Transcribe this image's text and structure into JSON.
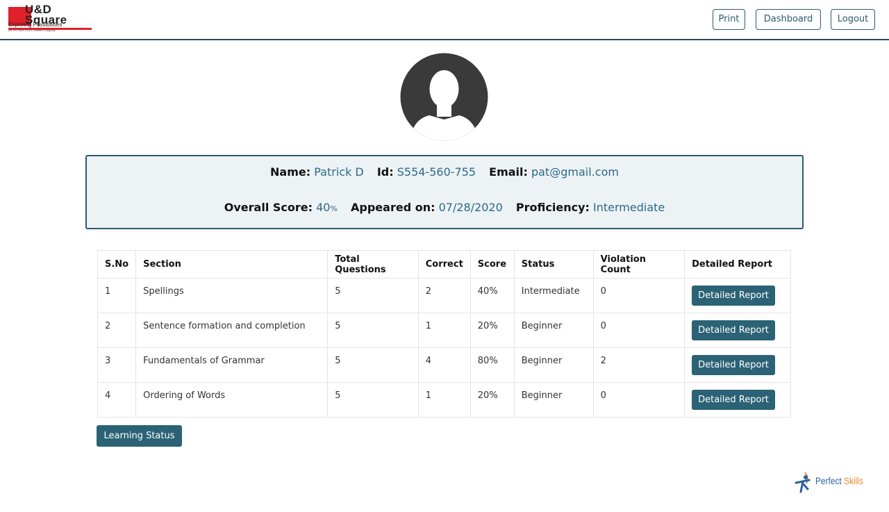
{
  "header": {
    "logo": {
      "brand": "U&D Square",
      "tagline": "Exploring Possibilities",
      "fine_print": "AN ISO 9001:2015 Certified Company"
    },
    "buttons": {
      "print": "Print",
      "dashboard": "Dashboard",
      "logout": "Logout"
    }
  },
  "profile": {
    "avatar_icon": "user-silhouette-icon",
    "name_label": "Name:",
    "name": "Patrick D",
    "id_label": "Id:",
    "id": "S554-560-755",
    "email_label": "Email:",
    "email": "pat@gmail.com",
    "overall_score_label": "Overall Score:",
    "overall_score": "40",
    "overall_score_unit": "%",
    "appeared_on_label": "Appeared on:",
    "appeared_on": "07/28/2020",
    "proficiency_label": "Proficiency:",
    "proficiency": "Intermediate"
  },
  "table": {
    "headers": [
      "S.No",
      "Section",
      "Total Questions",
      "Correct",
      "Score",
      "Status",
      "Violation Count",
      "Detailed Report"
    ],
    "rows": [
      {
        "sno": "1",
        "section": "Spellings",
        "total": "5",
        "correct": "2",
        "score": "40%",
        "status": "Intermediate",
        "violations": "0",
        "report": "Detailed Report"
      },
      {
        "sno": "2",
        "section": "Sentence formation and completion",
        "total": "5",
        "correct": "1",
        "score": "20%",
        "status": "Beginner",
        "violations": "0",
        "report": "Detailed Report"
      },
      {
        "sno": "3",
        "section": "Fundamentals of Grammar",
        "total": "5",
        "correct": "4",
        "score": "80%",
        "status": "Beginner",
        "violations": "2",
        "report": "Detailed Report"
      },
      {
        "sno": "4",
        "section": "Ordering of Words",
        "total": "5",
        "correct": "1",
        "score": "20%",
        "status": "Beginner",
        "violations": "0",
        "report": "Detailed Report"
      }
    ]
  },
  "learning_status_label": "Learning Status",
  "footer": {
    "brand_part1": "Perfect",
    "brand_part2": "Skills"
  },
  "colors": {
    "primary": "#2b6275",
    "value_text": "#2b6a86",
    "info_bg": "#edf2f5",
    "logo_red": "#e0202a"
  }
}
